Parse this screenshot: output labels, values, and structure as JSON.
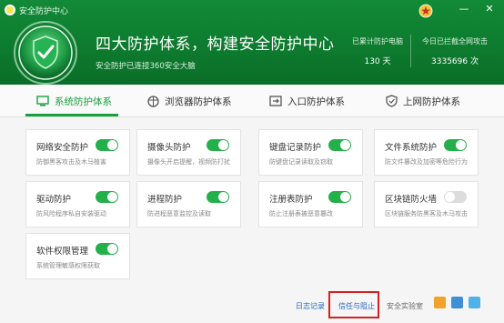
{
  "window": {
    "title": "安全防护中心",
    "controls": [
      "minimize",
      "close"
    ]
  },
  "header": {
    "headline": "四大防护体系，构建安全防护中心",
    "subline": "安全防护已连接360安全大脑",
    "stats": [
      {
        "label": "已累计防护电脑",
        "value": "130 天"
      },
      {
        "label": "今日已拦截全网攻击",
        "value": "3335696 次"
      }
    ],
    "colors": {
      "header_bg": "#0d7a2e",
      "accent": "#18a03f"
    }
  },
  "tabs": [
    {
      "label": "系统防护体系",
      "icon": "monitor-icon",
      "active": true
    },
    {
      "label": "浏览器防护体系",
      "icon": "browser-icon",
      "active": false
    },
    {
      "label": "入口防护体系",
      "icon": "entrance-icon",
      "active": false
    },
    {
      "label": "上网防护体系",
      "icon": "shield-icon",
      "active": false
    }
  ],
  "cards": [
    {
      "name": "网络安全防护",
      "desc": "防御黑客攻击及木马植害",
      "enabled": true
    },
    {
      "name": "摄像头防护",
      "desc": "摄像头开启提醒，视频防打扰",
      "enabled": true
    },
    {
      "name": "键盘记录防护",
      "desc": "防键盘记录读取及窃取",
      "enabled": true
    },
    {
      "name": "文件系统防护",
      "desc": "防文件篡改及加密等危险行为",
      "enabled": true
    },
    {
      "name": "驱动防护",
      "desc": "防风险程序私自安装驱动",
      "enabled": true
    },
    {
      "name": "进程防护",
      "desc": "防进程恶意监控及读取",
      "enabled": true
    },
    {
      "name": "注册表防护",
      "desc": "防止注册表被恶意篡改",
      "enabled": true
    },
    {
      "name": "区块链防火墙",
      "desc": "区块链服务防黑客及木马攻击",
      "enabled": false
    },
    {
      "name": "软件权限管理",
      "desc": "系统管理敏感权限获取",
      "enabled": true
    }
  ],
  "footer": {
    "links": [
      "日志记录",
      "信任与阻止",
      "安全实验室"
    ],
    "icons": [
      "plugin-icon",
      "settings-icon",
      "help-icon"
    ]
  }
}
